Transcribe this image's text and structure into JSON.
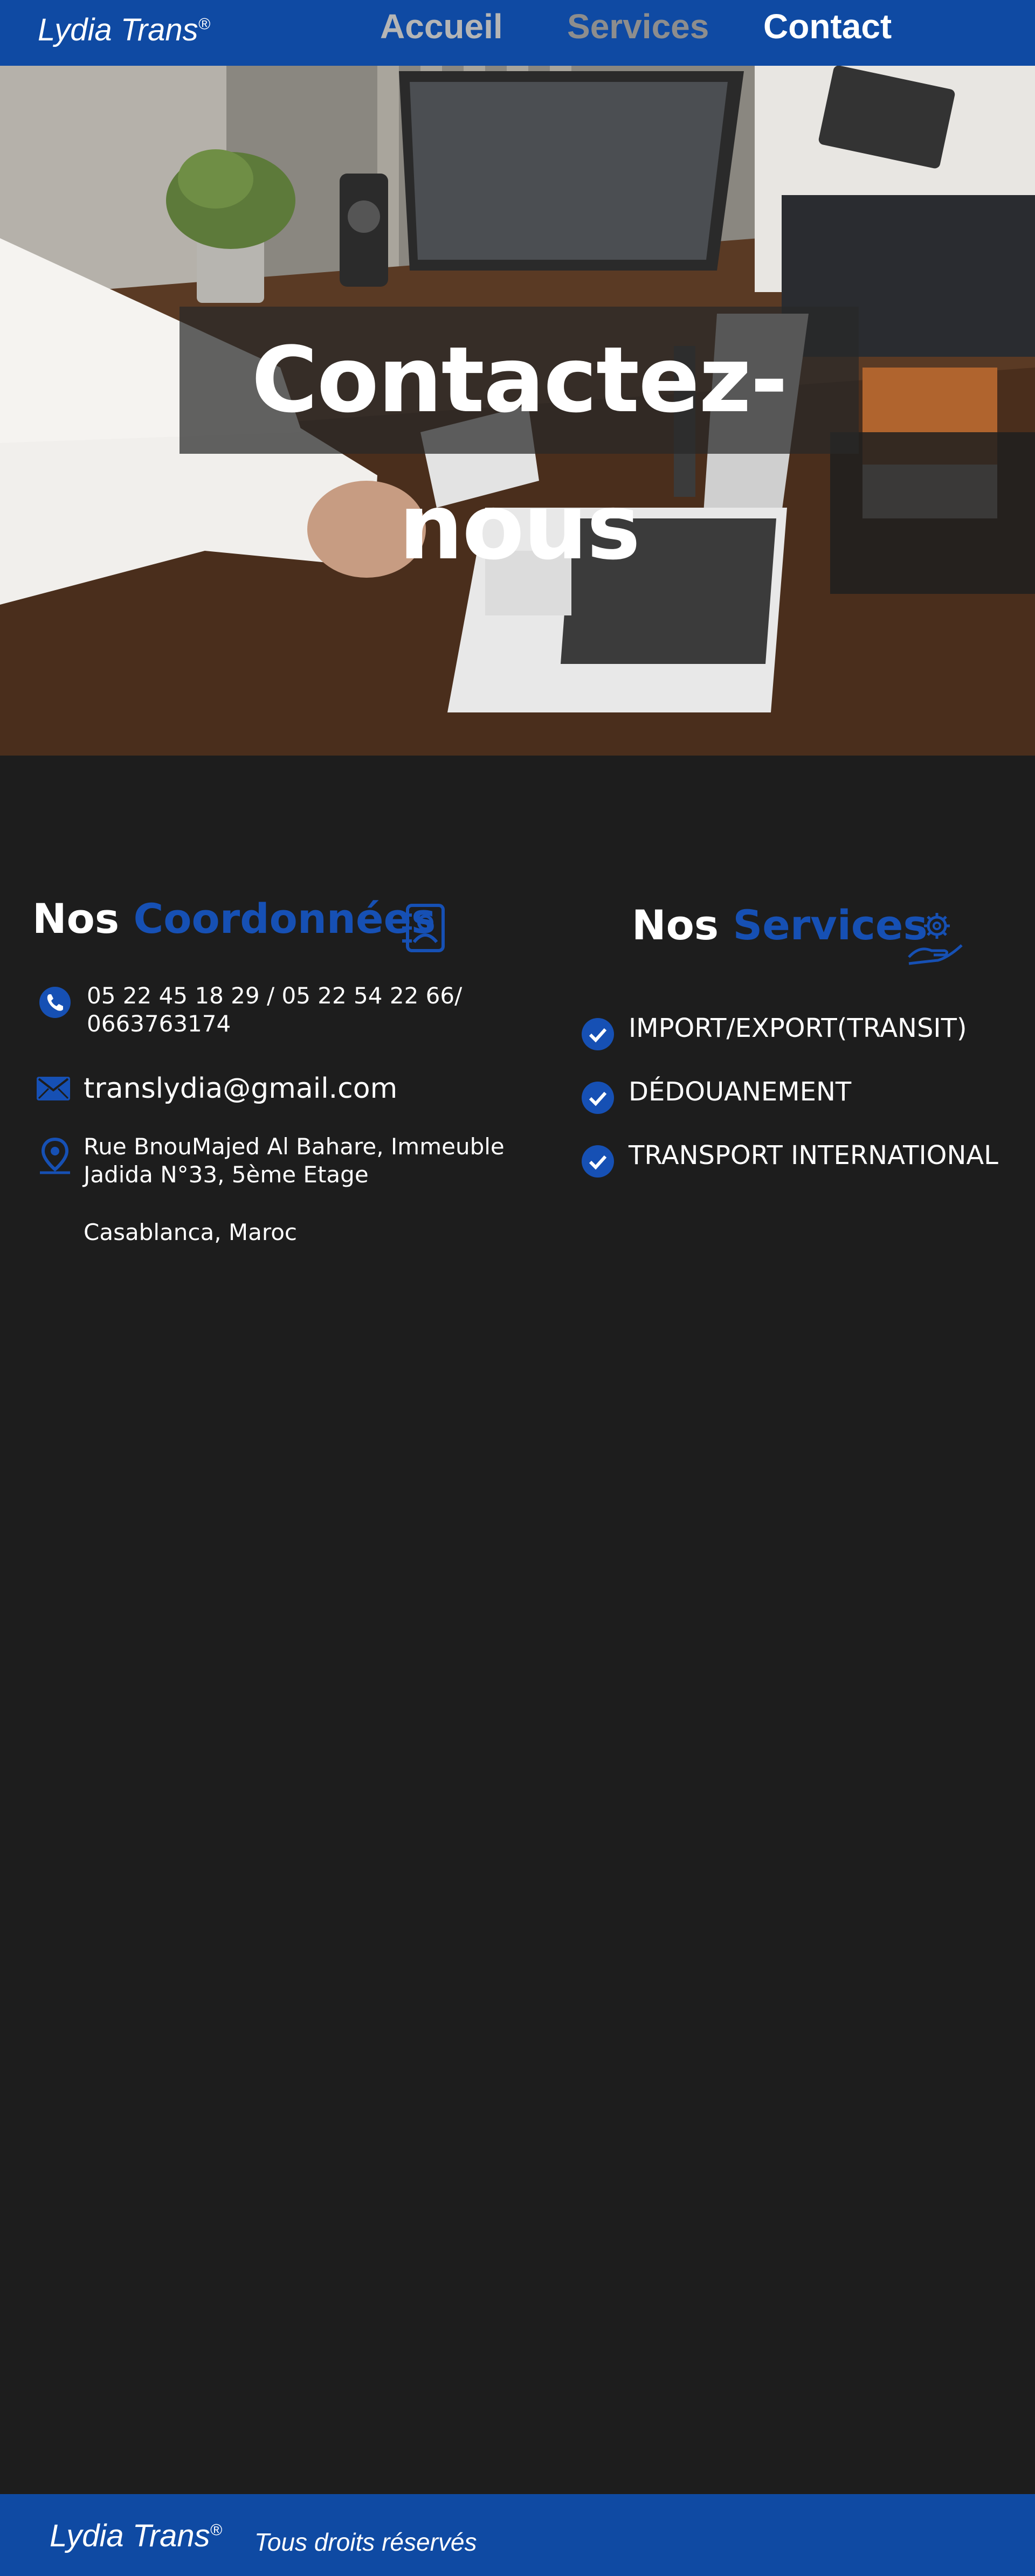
{
  "header": {
    "brand": "Lydia Trans",
    "brand_mark": "®",
    "nav": [
      {
        "label": "Accueil"
      },
      {
        "label": "Services"
      },
      {
        "label": "Contact"
      }
    ]
  },
  "hero": {
    "title": "Contactez-nous"
  },
  "coordinates": {
    "title_prefix": "Nos",
    "title_highlight": "Coordonnées",
    "title_icon": "contact-book-icon",
    "phone": "05 22 45 18 29 / 05 22 54 22 66/ 0663763174",
    "phone_icon": "phone-icon",
    "email": "translydia@gmail.com",
    "email_icon": "envelope-icon",
    "address": "Rue BnouMajed Al Bahare, Immeuble Jadida N°33, 5ème Etage",
    "city": "Casablanca, Maroc",
    "address_icon": "location-pin-icon"
  },
  "services": {
    "title_prefix": "Nos",
    "title_highlight": "Services",
    "title_icon": "gear-hand-icon",
    "items": [
      {
        "label": "IMPORT/EXPORT(TRANSIT)",
        "icon": "check-circle-icon"
      },
      {
        "label": "DÉDOUANEMENT",
        "icon": "check-circle-icon"
      },
      {
        "label": "TRANSPORT INTERNATIONAL",
        "icon": "check-circle-icon"
      }
    ]
  },
  "footer": {
    "brand": "Lydia Trans",
    "brand_mark": "®",
    "rights": "Tous droits réservés"
  },
  "colors": {
    "primary_blue": "#0f4aa3",
    "accent_blue": "#1650b4",
    "background": "#1d1d1d",
    "text": "#ffffff"
  }
}
